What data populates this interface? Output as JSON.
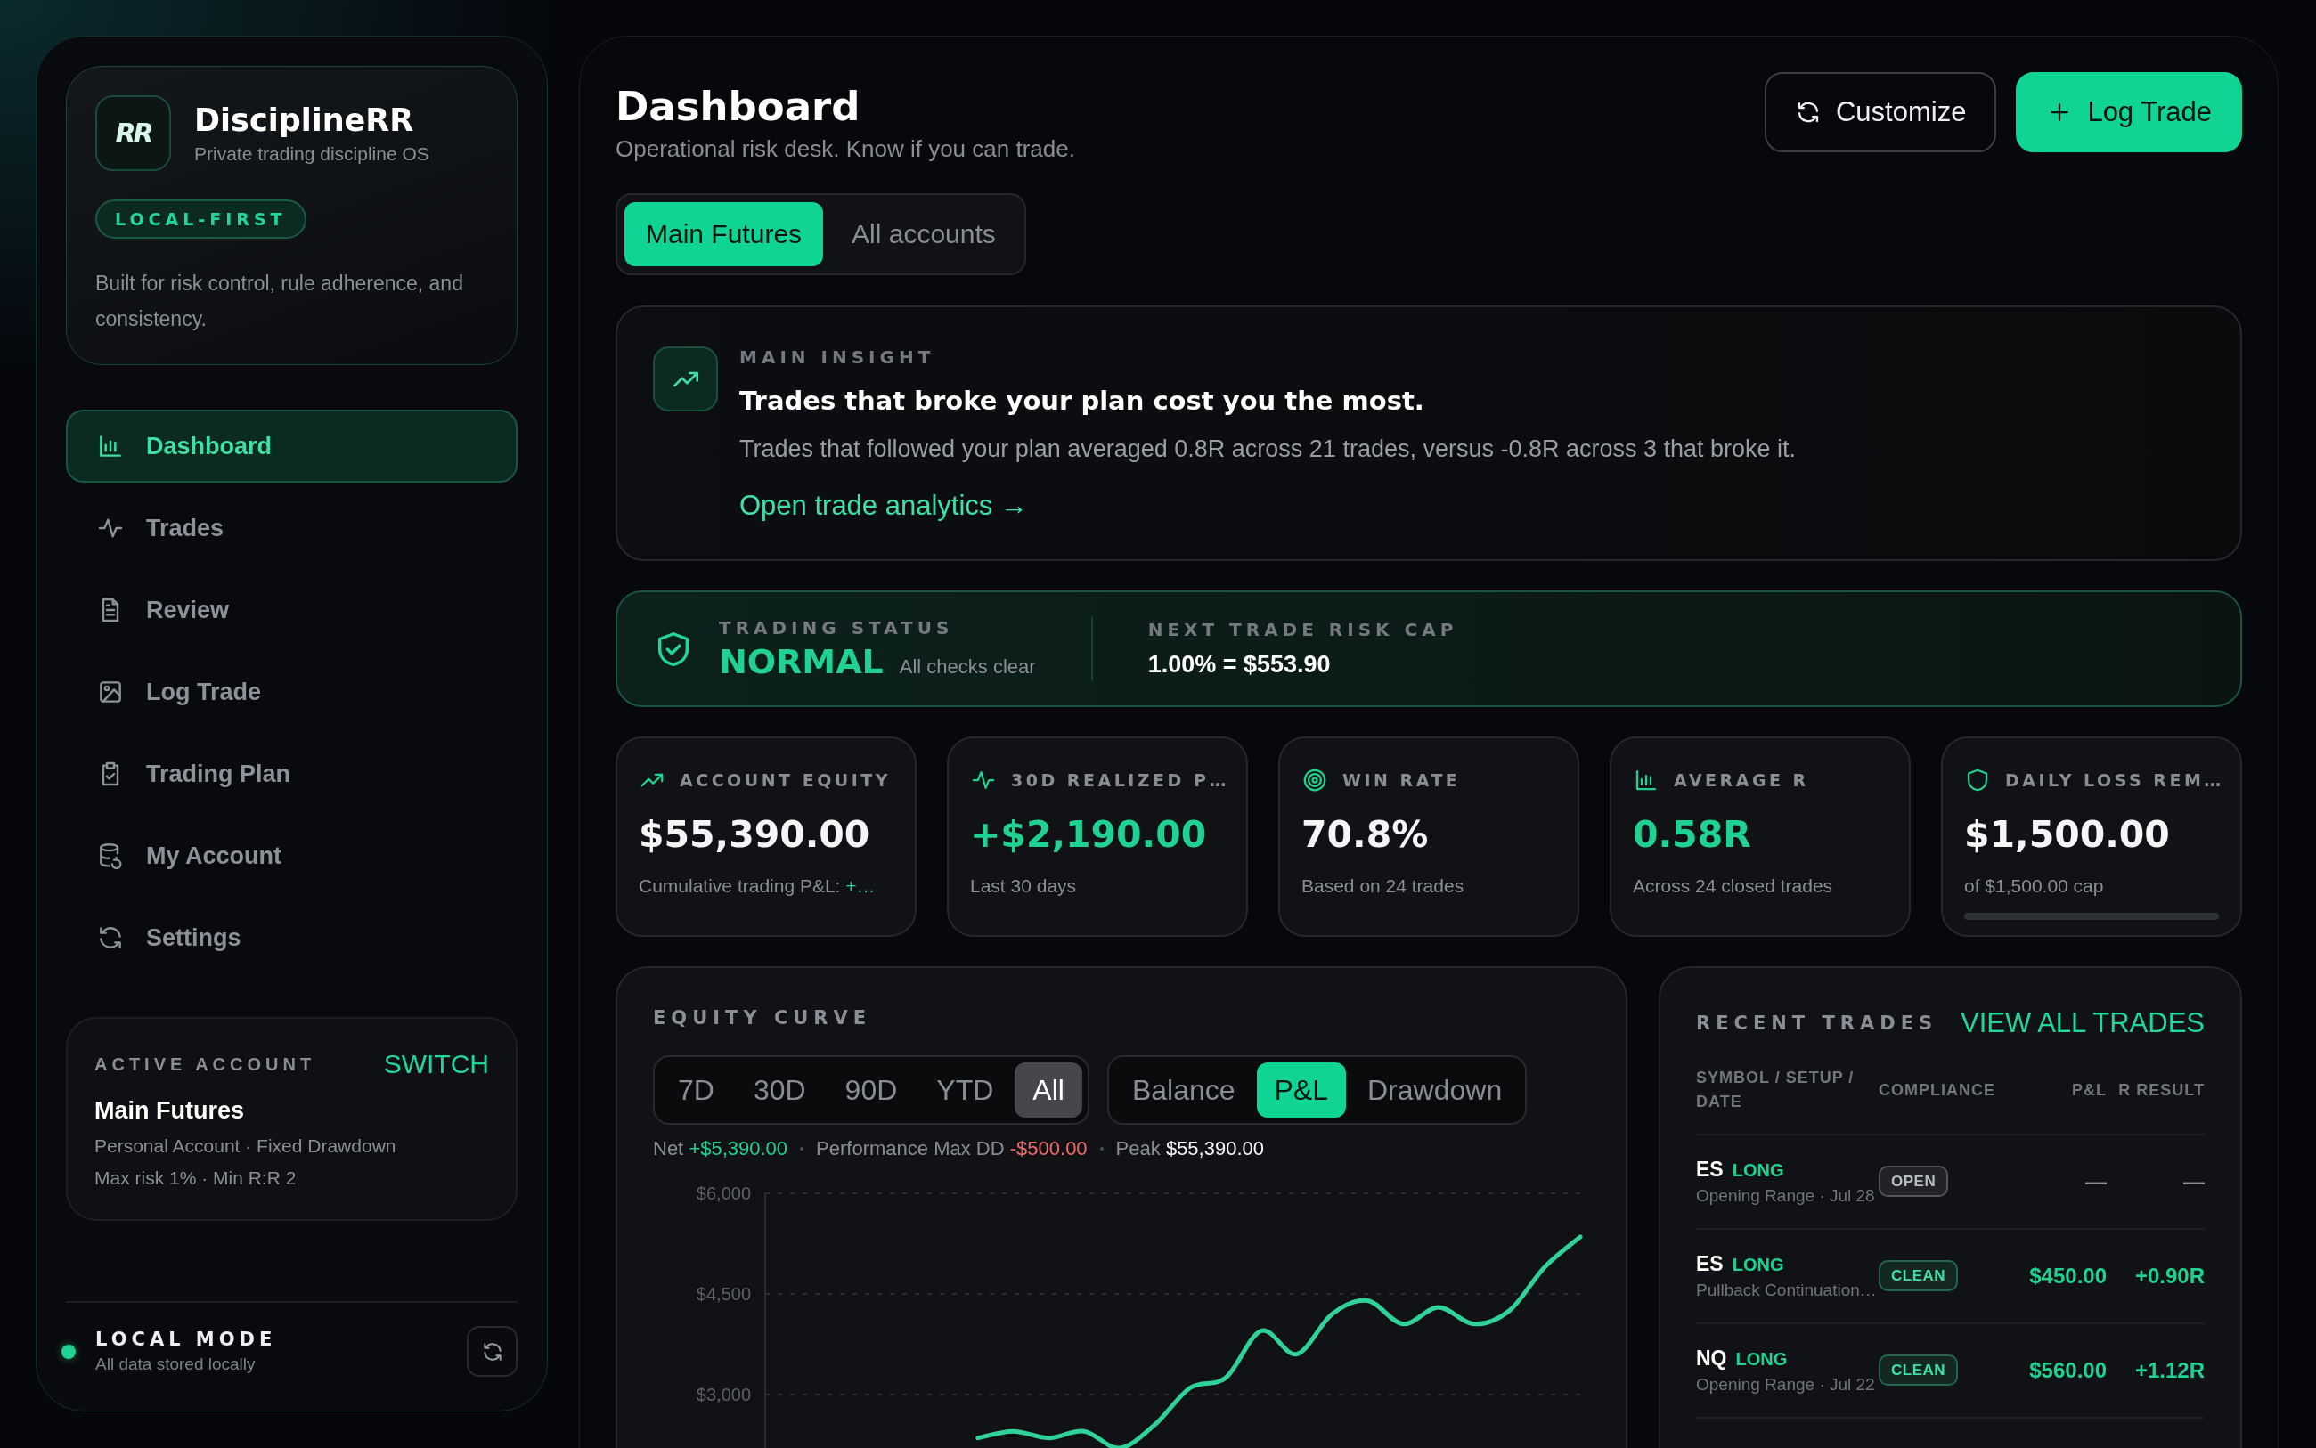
{
  "sidebar": {
    "brand": {
      "logo_text": "RR",
      "name": "DisciplineRR",
      "tagline": "Private trading discipline OS",
      "badge": "LOCAL-FIRST",
      "description": "Built for risk control, rule adherence, and consistency."
    },
    "nav": [
      {
        "label": "Dashboard",
        "selected": true
      },
      {
        "label": "Trades",
        "selected": false
      },
      {
        "label": "Review",
        "selected": false
      },
      {
        "label": "Log Trade",
        "selected": false
      },
      {
        "label": "Trading Plan",
        "selected": false
      },
      {
        "label": "My Account",
        "selected": false
      },
      {
        "label": "Settings",
        "selected": false
      }
    ],
    "active_account": {
      "label": "ACTIVE ACCOUNT",
      "action": "SWITCH",
      "name": "Main Futures",
      "meta": [
        "Personal Account · Fixed Drawdown",
        "Max risk 1% · Min R:R 2"
      ]
    },
    "local_mode": {
      "title": "LOCAL MODE",
      "subtitle": "All data stored locally",
      "online": true
    }
  },
  "header": {
    "title": "Dashboard",
    "subtitle": "Operational risk desk. Know if you can trade.",
    "buttons": [
      {
        "label": "Customize",
        "kind": "secondary"
      },
      {
        "label": "Log Trade",
        "kind": "primary"
      }
    ]
  },
  "account_tabs": [
    {
      "label": "Main Futures",
      "selected": true
    },
    {
      "label": "All accounts",
      "selected": false
    }
  ],
  "insight": {
    "label": "MAIN INSIGHT",
    "headline": "Trades that broke your plan cost you the most.",
    "body": "Trades that followed your plan averaged 0.8R across 21 trades, versus -0.8R across 3 that broke it.",
    "link": "Open trade analytics →"
  },
  "trading_status": {
    "label": "TRADING STATUS",
    "value": "NORMAL",
    "note": "All checks clear",
    "risk_label": "NEXT TRADE RISK CAP",
    "risk_value": "1.00% = $553.90"
  },
  "kpis": [
    {
      "label": "ACCOUNT EQUITY",
      "value": "$55,390.00",
      "color": "#f3f5f7",
      "sub": "Cumulative trading P&L:",
      "sub_value": "+…"
    },
    {
      "label": "30D REALIZED P…",
      "value": "+$2,190.00",
      "color": "#1fd192",
      "sub": "Last 30 days"
    },
    {
      "label": "WIN RATE",
      "value": "70.8%",
      "color": "#f3f5f7",
      "sub": "Based on 24 trades"
    },
    {
      "label": "AVERAGE R",
      "value": "0.58R",
      "color": "#1fd192",
      "sub": "Across 24 closed trades"
    },
    {
      "label": "DAILY LOSS REM…",
      "value": "$1,500.00",
      "color": "#f3f5f7",
      "sub": "of $1,500.00 cap",
      "level": 1
    }
  ],
  "equity_curve": {
    "title": "EQUITY CURVE",
    "ranges": [
      {
        "label": "7D",
        "selected": false
      },
      {
        "label": "30D",
        "selected": false
      },
      {
        "label": "90D",
        "selected": false
      },
      {
        "label": "YTD",
        "selected": false
      },
      {
        "label": "All",
        "selected": true
      }
    ],
    "modes": [
      {
        "label": "Balance",
        "selected": false
      },
      {
        "label": "P&L",
        "selected": true
      },
      {
        "label": "Drawdown",
        "selected": false
      }
    ],
    "stats": [
      {
        "label": "Net",
        "value": "+$5,390.00",
        "color": "#1fd192"
      },
      {
        "label": "Performance Max DD",
        "value": "-$500.00",
        "color": "#f06a6a"
      },
      {
        "label": "Peak",
        "value": "$55,390.00",
        "color": "#f3f5f7"
      }
    ],
    "chart_data": {
      "type": "line",
      "grid": true,
      "ylim": [
        2200,
        6000
      ],
      "yticks": [
        {
          "value": 3000,
          "label": "$3,000"
        },
        {
          "value": 4500,
          "label": "$4,500"
        },
        {
          "value": 6000,
          "label": "$6,000"
        }
      ],
      "series": [
        {
          "color": "#2fd39a",
          "values": [
            null,
            null,
            null,
            null,
            null,
            null,
            2350,
            2450,
            2350,
            2450,
            2200,
            2550,
            3100,
            3250,
            3950,
            3600,
            4200,
            4400,
            4050,
            4300,
            4050,
            4250,
            4900,
            5350
          ]
        }
      ]
    }
  },
  "recent_trades": {
    "title": "RECENT TRADES",
    "link": "VIEW ALL TRADES",
    "columns": [
      "SYMBOL / SETUP / DATE",
      "COMPLIANCE",
      "P&L",
      "R RESULT"
    ],
    "rows": [
      {
        "symbol": "ES",
        "side": "LONG",
        "setup": "Opening Range · Jul 28",
        "compliance": {
          "label": "OPEN",
          "color": "#b8bbc0"
        },
        "pnl": "—",
        "r": "—",
        "color": "#8a8e94"
      },
      {
        "symbol": "ES",
        "side": "LONG",
        "setup": "Pullback Continuation…",
        "compliance": {
          "label": "CLEAN",
          "color": "#3fe0a8"
        },
        "pnl": "$450.00",
        "r": "+0.90R",
        "color": "#1fd192"
      },
      {
        "symbol": "NQ",
        "side": "LONG",
        "setup": "Opening Range · Jul 22",
        "compliance": {
          "label": "CLEAN",
          "color": "#3fe0a8"
        },
        "pnl": "$560.00",
        "r": "+1.12R",
        "color": "#1fd192"
      }
    ]
  }
}
